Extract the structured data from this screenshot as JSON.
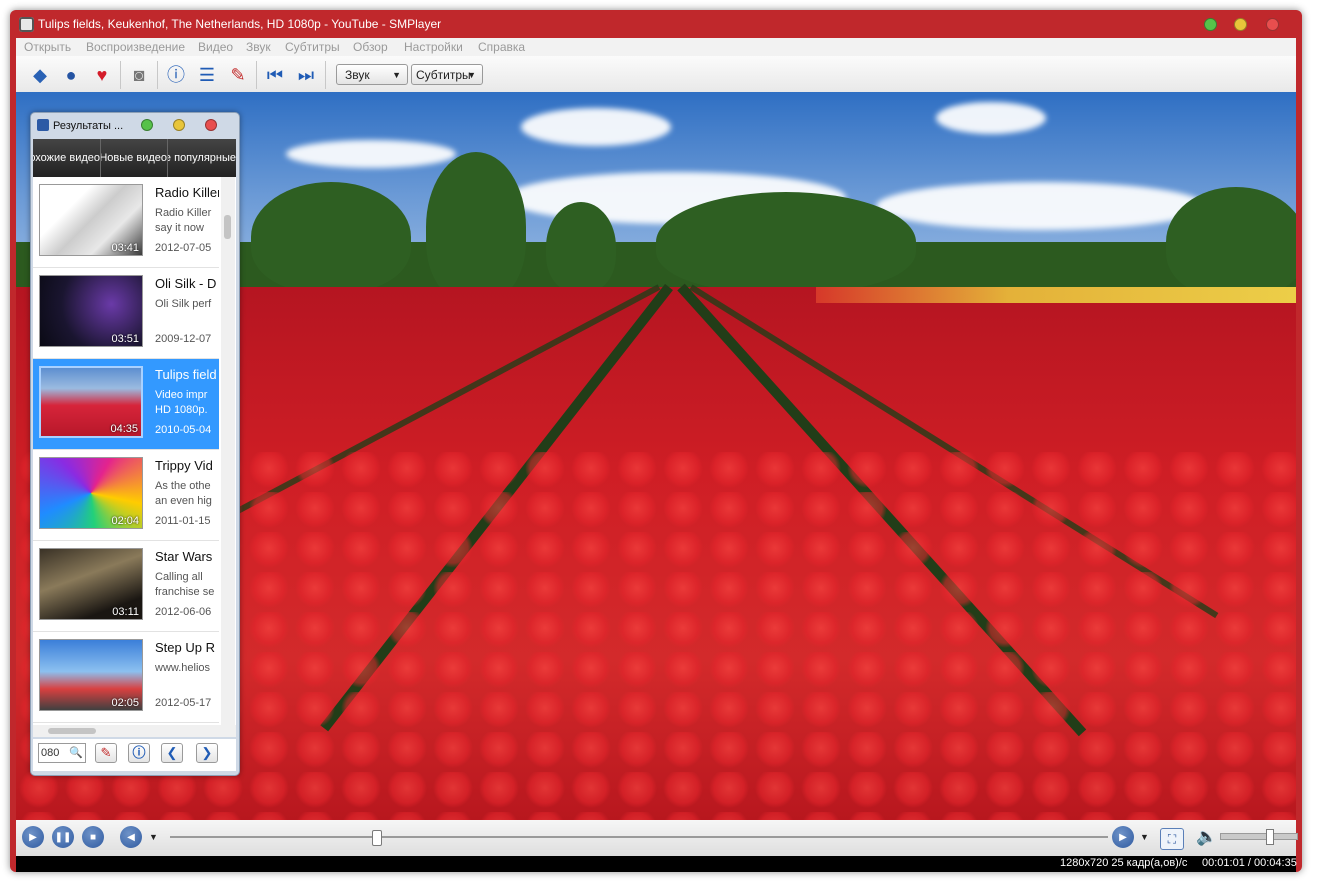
{
  "window": {
    "title": "Tulips fields, Keukenhof, The Netherlands, HD 1080p - YouTube - SMPlayer",
    "frame_color": "#c0282c"
  },
  "menubar": {
    "items": [
      "Открыть",
      "Воспроизведение",
      "Видео",
      "Звук",
      "Субтитры",
      "Обзор",
      "Настройки",
      "Справка"
    ]
  },
  "toolbar": {
    "icons": [
      "open-file-icon",
      "web-icon",
      "favorites-icon",
      "screenshot-icon",
      "info-icon",
      "playlist-icon",
      "preferences-icon",
      "previous-icon",
      "next-icon"
    ],
    "audio_label": "Звук",
    "subtitles_label": "Субтитры"
  },
  "youtube_panel": {
    "title": "Результаты ...",
    "tabs": [
      "Похожие видео",
      "Новые видео",
      "Самые популярные"
    ],
    "items": [
      {
        "title": "Radio Killer",
        "desc": [
          "Radio Killer",
          "say it now"
        ],
        "date": "2012-07-05",
        "duration": "03:41",
        "selected": false
      },
      {
        "title": "Oli Silk - D",
        "desc": [
          "Oli Silk perf"
        ],
        "date": "2009-12-07",
        "duration": "03:51",
        "selected": false
      },
      {
        "title": "Tulips field",
        "desc": [
          "Video impr",
          "HD 1080p."
        ],
        "date": "2010-05-04",
        "duration": "04:35",
        "selected": true
      },
      {
        "title": "Trippy Vid",
        "desc": [
          "As the othe",
          "an even hig"
        ],
        "date": "2011-01-15",
        "duration": "02:04",
        "selected": false
      },
      {
        "title": "Star Wars",
        "desc": [
          "Calling all",
          "franchise se"
        ],
        "date": "2012-06-06",
        "duration": "03:11",
        "selected": false
      },
      {
        "title": "Step Up R",
        "desc": [
          "www.helios"
        ],
        "date": "2012-05-17",
        "duration": "02:05",
        "selected": false
      }
    ],
    "search_value": "080"
  },
  "controls": {
    "seek_fraction": 0.22,
    "volume_fraction": 0.63
  },
  "status": {
    "info": "1280x720 25 кадр(а,ов)/с",
    "time": "00:01:01 / 00:04:35"
  }
}
